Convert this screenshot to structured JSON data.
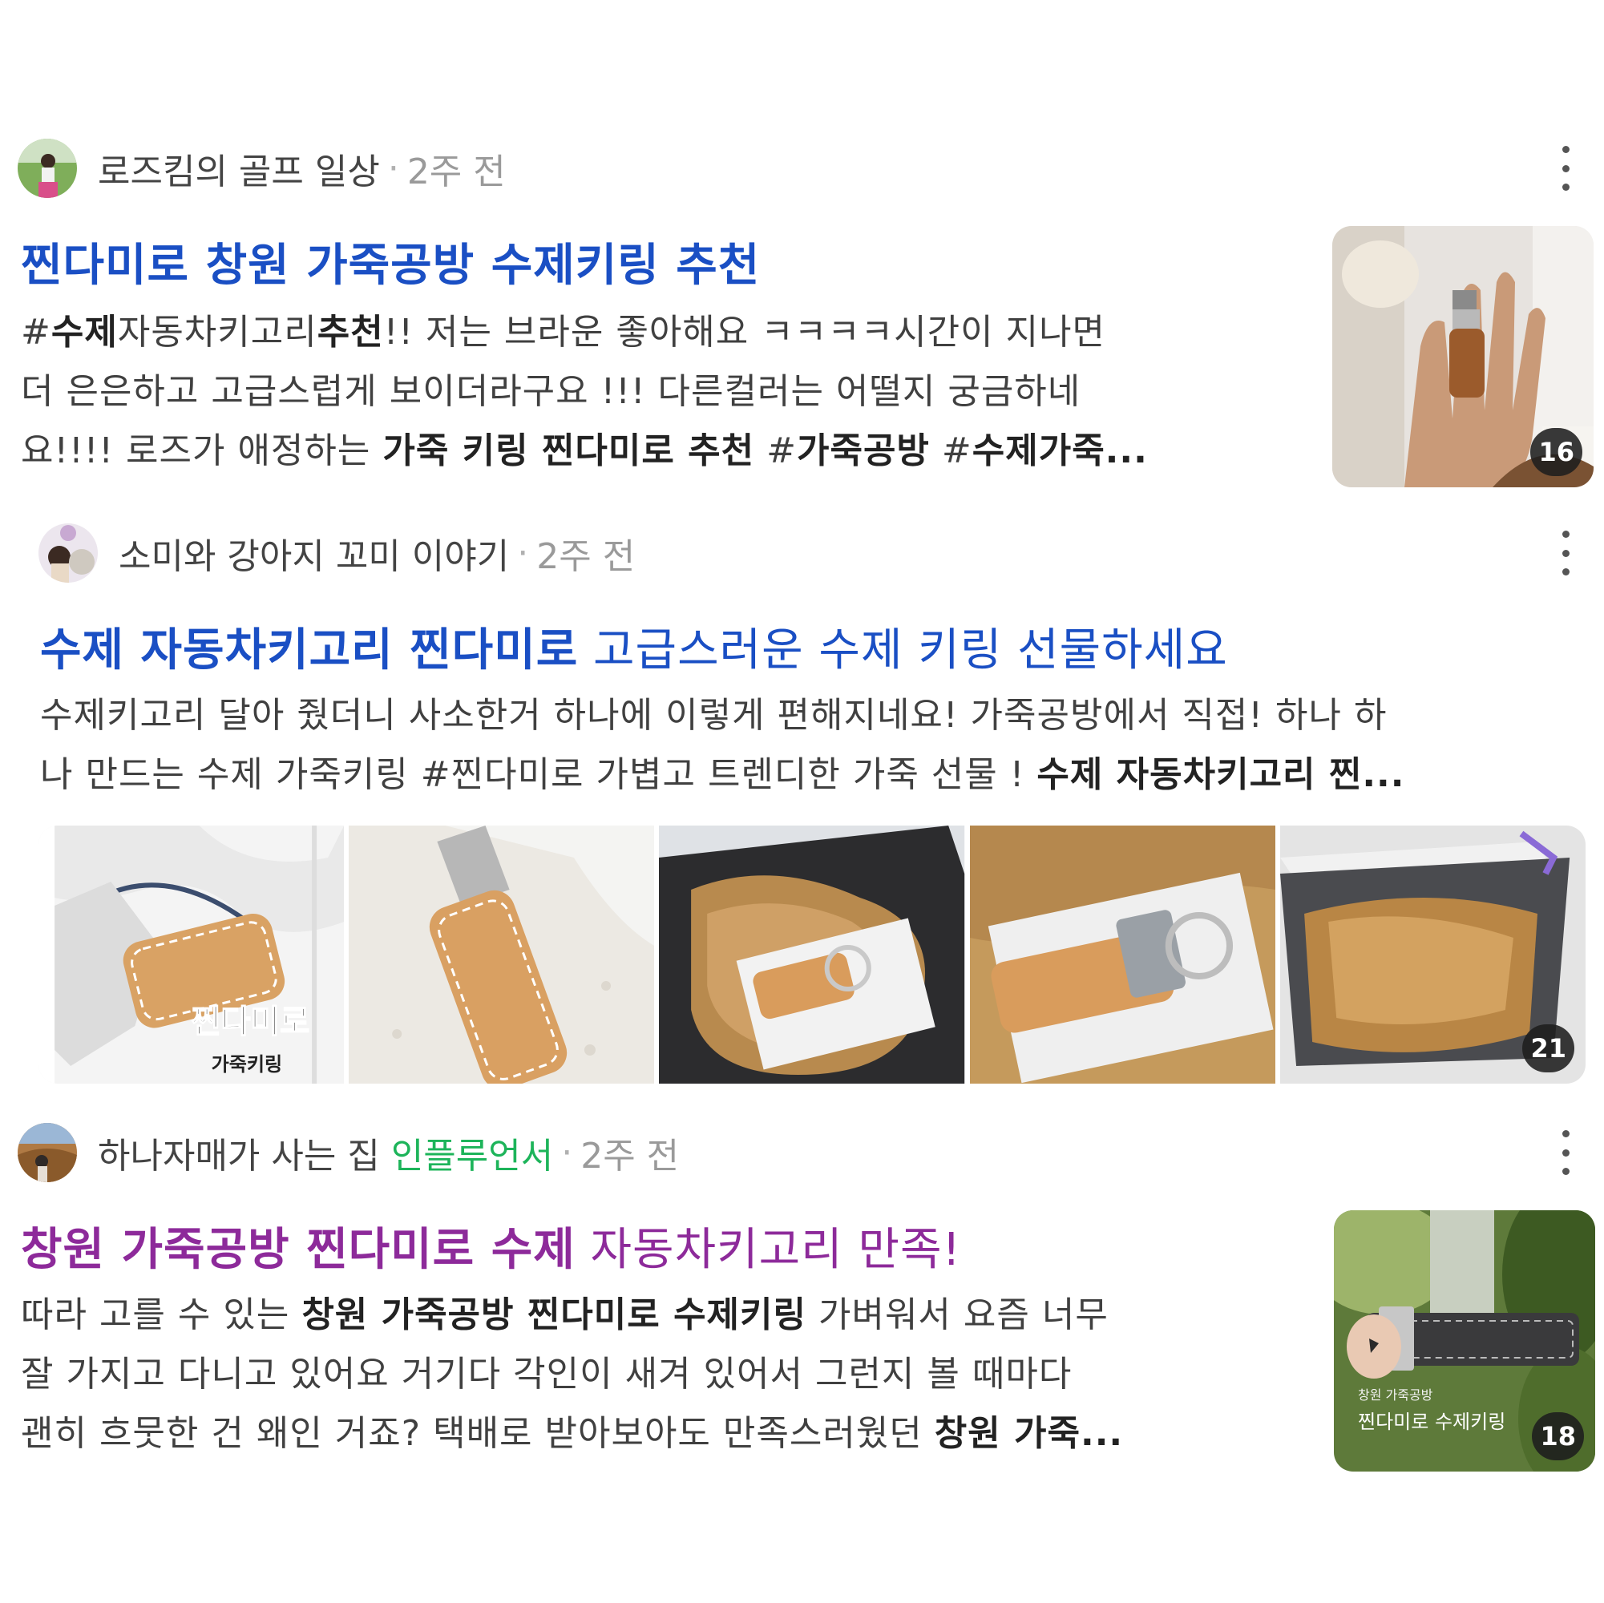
{
  "posts": [
    {
      "author": "로즈킴의 골프 일상",
      "sep": "·",
      "time": "2주 전",
      "title_bold": "찐다미로 창원 가죽공방 수제키링 추천",
      "lines": [
        [
          "#",
          {
            "b": "수제"
          },
          "자동차키고리",
          {
            "b": "추천"
          },
          "!! 저는 브라운 좋아해요 ㅋㅋㅋㅋ시간이 지나면"
        ],
        [
          "더 은은하고 고급스럽게 보이더라구요 !!! 다른컬러는 어떨지 궁금하네"
        ],
        [
          "요!!!! 로즈가 애정하는 ",
          {
            "b": "가죽 키링 찐다미로 추천"
          },
          " #",
          {
            "b": "가죽공방"
          },
          " #",
          {
            "b": "수제가죽..."
          }
        ]
      ],
      "badge": "16"
    },
    {
      "author": "소미와 강아지 꼬미 이야기",
      "sep": "·",
      "time": "2주 전",
      "title_bold": "수제 자동차키고리 찐다미로",
      "title_rest": " 고급스러운 수제 키링 선물하세요",
      "lines": [
        [
          "수제키고리 달아 줬더니 사소한거 하나에 이렇게 편해지네요! 가죽공방에서 직접! 하나 하"
        ],
        [
          "나 만드는 수제 가죽키링 #찐다미로 가볍고 트렌디한 가죽 선물 ! ",
          {
            "b": "수제 자동차키고리 찐..."
          }
        ]
      ],
      "badge": "21",
      "strip_overlay_text": {
        "line1": "찐다미로",
        "line2": "가죽키링"
      }
    },
    {
      "author": "하나자매가 사는 집",
      "influencer": "인플루언서",
      "sep": "·",
      "time": "2주 전",
      "title_bold": "창원 가죽공방 찐다미로 수제",
      "title_rest": " 자동차키고리 만족!",
      "lines": [
        [
          "따라 고를 수 있는 ",
          {
            "b": "창원 가죽공방 찐다미로 수제키링"
          },
          " 가벼워서 요즘 너무"
        ],
        [
          "잘 가지고 다니고 있어요 거기다 각인이 새겨 있어서 그런지 볼 때마다"
        ],
        [
          "괜히 흐뭇한 건 왜인 거죠? 택배로 받아보아도 만족스러웠던 ",
          {
            "b": "창원 가죽..."
          }
        ]
      ],
      "badge": "18",
      "thumb_caption": {
        "line1": "창원 가죽공방",
        "line2": "찐다미로 수제키링"
      }
    }
  ],
  "colors": {
    "title_blue": "#1a4fc4",
    "title_purple": "#8d2a9a",
    "influencer_green": "#1db45a",
    "time_gray": "#9a9a9a"
  }
}
